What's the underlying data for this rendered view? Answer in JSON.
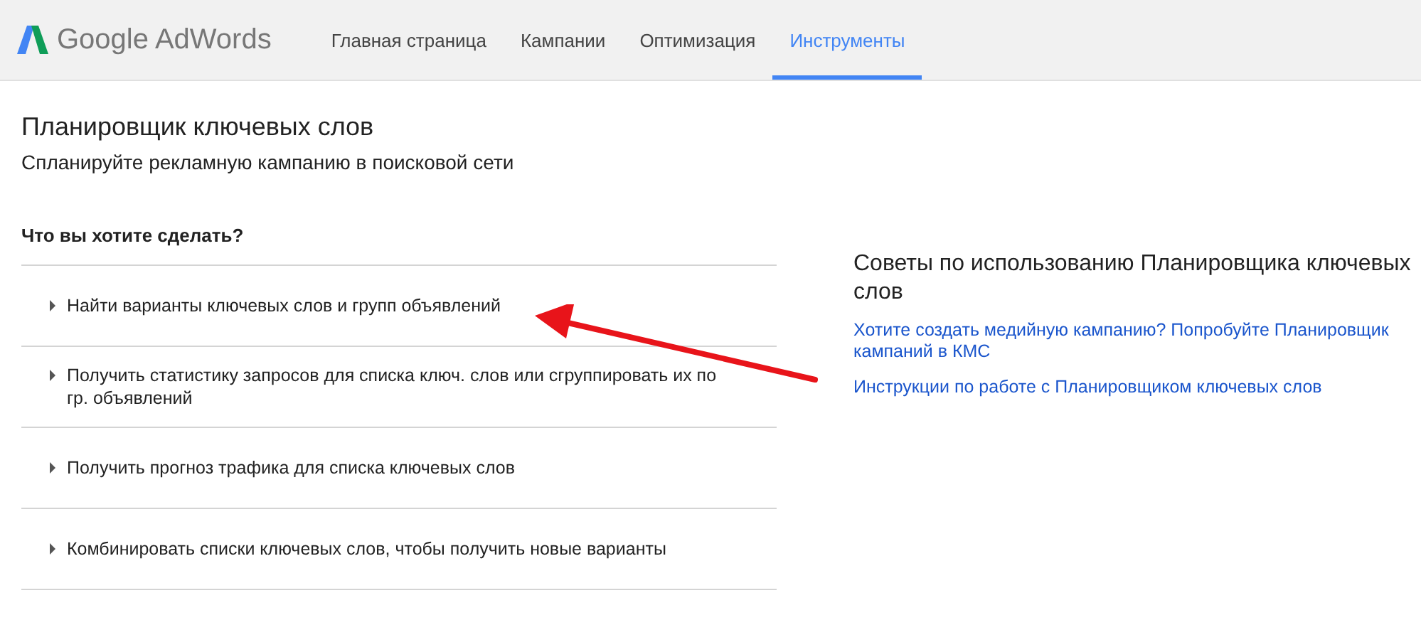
{
  "header": {
    "logo": "Google AdWords",
    "tabs": [
      {
        "label": "Главная страница",
        "selected": false
      },
      {
        "label": "Кампании",
        "selected": false
      },
      {
        "label": "Оптимизация",
        "selected": false
      },
      {
        "label": "Инструменты",
        "selected": true
      }
    ]
  },
  "page": {
    "title": "Планировщик ключевых слов",
    "subtitle": "Спланируйте рекламную кампанию в поисковой сети"
  },
  "question": "Что вы хотите сделать?",
  "options": [
    {
      "label": "Найти варианты ключевых слов и групп объявлений",
      "expanded": false
    },
    {
      "label": "Получить статистику запросов для списка ключ. слов или сгруппировать их по гр. объявлений",
      "expanded": false
    },
    {
      "label": "Получить прогноз трафика для списка ключевых слов",
      "expanded": false
    },
    {
      "label": "Комбинировать списки ключевых слов, чтобы получить новые варианты",
      "expanded": false
    }
  ],
  "tips": {
    "title": "Советы по использованию Планировщика ключевых слов",
    "links": [
      "Хотите создать медийную кампанию? Попробуйте Планировщик кампаний в КМС",
      "Инструкции по работе с Планировщиком ключевых слов"
    ]
  }
}
